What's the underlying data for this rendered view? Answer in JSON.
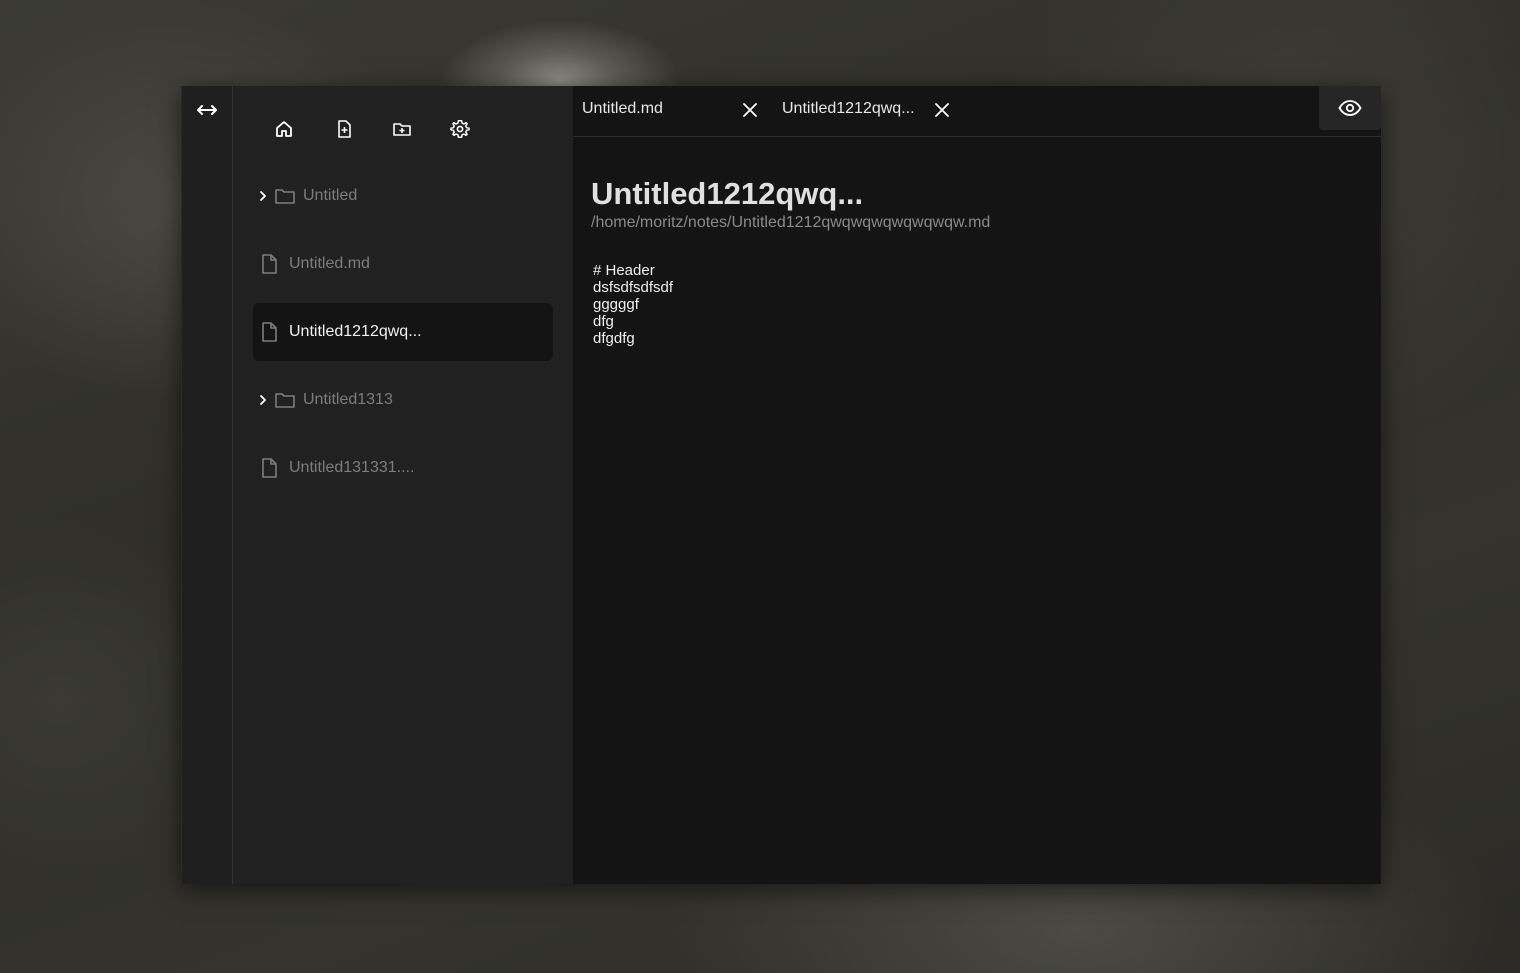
{
  "sidebar": {
    "toolbar": {
      "home_icon": "home-icon",
      "new_file_icon": "file-plus-icon",
      "new_folder_icon": "folder-plus-icon",
      "settings_icon": "gear-icon"
    },
    "items": [
      {
        "type": "folder",
        "label": "Untitled",
        "expandable": true,
        "active": false
      },
      {
        "type": "file",
        "label": "Untitled.md",
        "active": false
      },
      {
        "type": "file",
        "label": "Untitled1212qwq...",
        "active": true
      },
      {
        "type": "folder",
        "label": "Untitled1313",
        "expandable": true,
        "active": false
      },
      {
        "type": "file",
        "label": "Untitled131331....",
        "active": false
      }
    ]
  },
  "tabs": [
    {
      "label": "Untitled.md"
    },
    {
      "label": "Untitled1212qwq..."
    }
  ],
  "document": {
    "title": "Untitled1212qwq...",
    "path": "/home/moritz/notes/Untitled1212qwqwqwqwqwqwqw.md",
    "lines": [
      "# Header",
      "",
      "dsfsdfsdfsdf",
      "",
      "",
      "",
      "",
      "gggggf",
      "dfg",
      "dfgdfg"
    ]
  },
  "colors": {
    "rail": "#1f1f1f",
    "sidebar": "#212121",
    "main": "#141414",
    "active_item": "#141414",
    "muted_text": "#7d7d7d"
  }
}
